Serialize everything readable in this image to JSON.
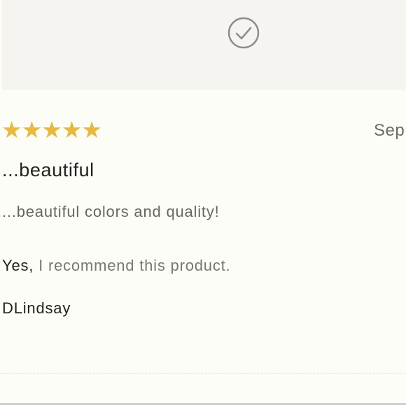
{
  "top_panel": {
    "icon": "check-circle-icon"
  },
  "review": {
    "rating": 5,
    "rating_max": 5,
    "star_color": "#e8b93a",
    "date": "Sep",
    "title": "...beautiful",
    "body": "...beautiful colors and quality!",
    "recommend_prefix": "Yes,",
    "recommend_text": " I recommend this product.",
    "author": "DLindsay"
  }
}
